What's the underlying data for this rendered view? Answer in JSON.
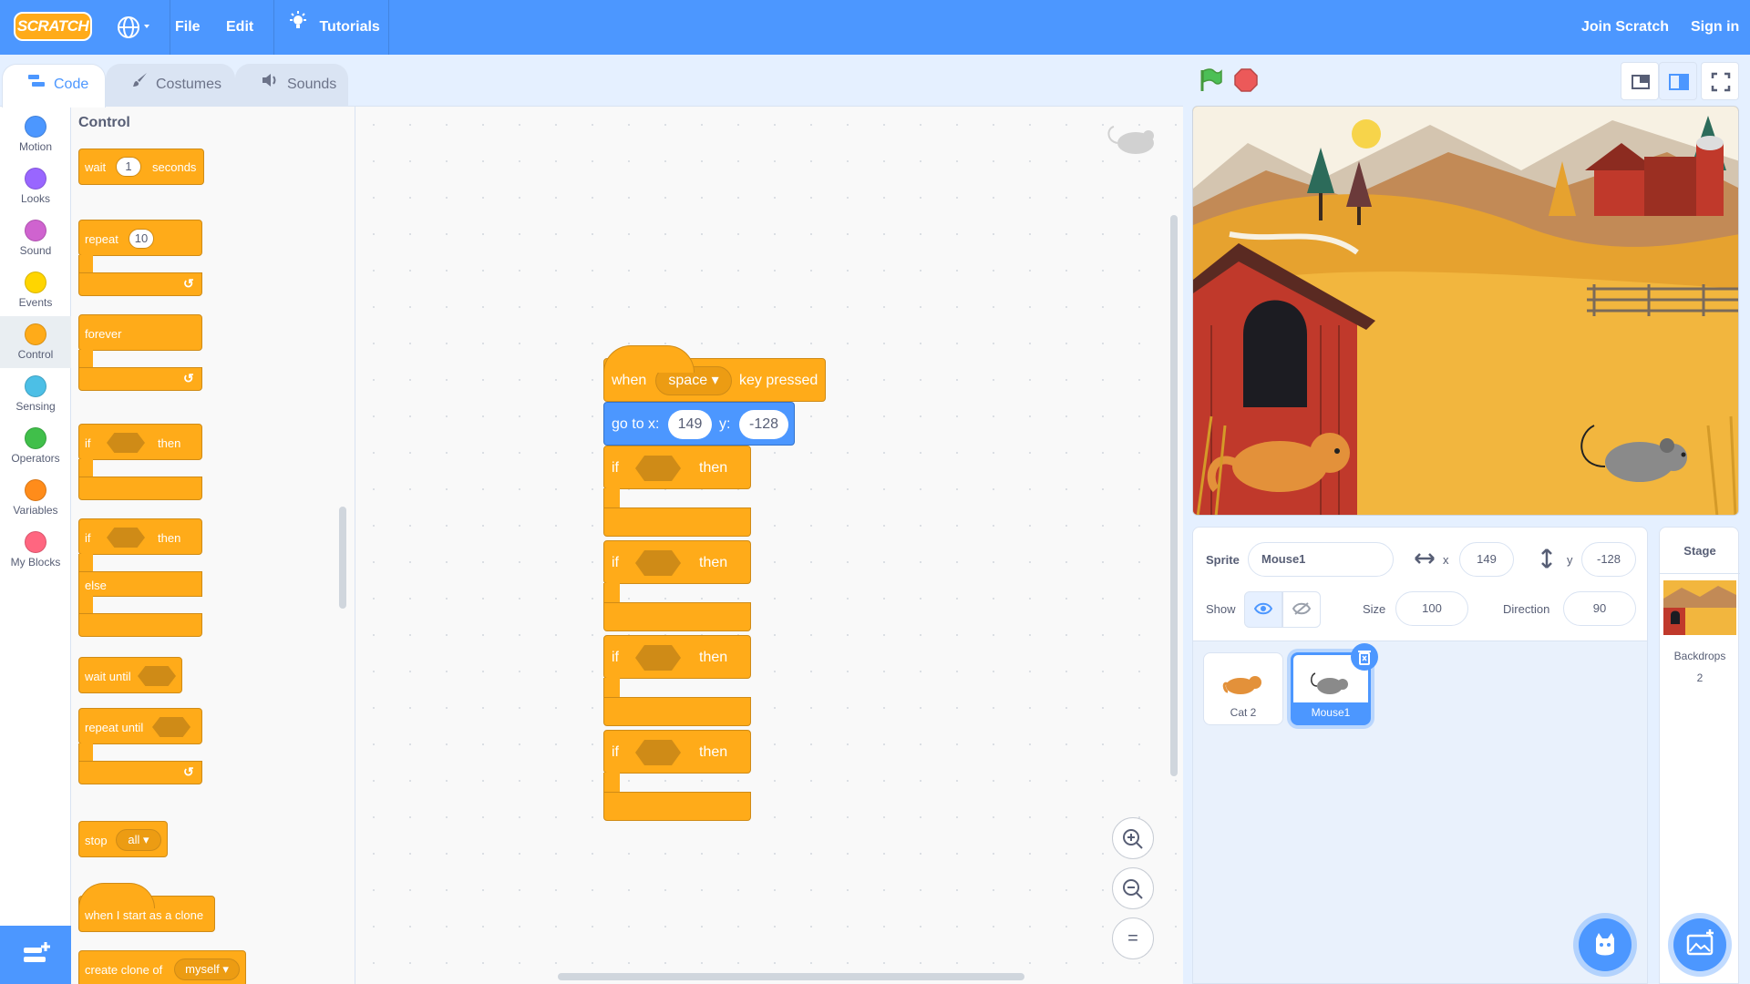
{
  "menubar": {
    "logo_text": "SCRATCH",
    "file": "File",
    "edit": "Edit",
    "tutorials": "Tutorials",
    "join": "Join Scratch",
    "signin": "Sign in"
  },
  "tabs": [
    {
      "label": "Code"
    },
    {
      "label": "Costumes"
    },
    {
      "label": "Sounds"
    }
  ],
  "categories": [
    {
      "label": "Motion",
      "color": "#4c97ff"
    },
    {
      "label": "Looks",
      "color": "#9966ff"
    },
    {
      "label": "Sound",
      "color": "#cf63cf"
    },
    {
      "label": "Events",
      "color": "#ffd500"
    },
    {
      "label": "Control",
      "color": "#ffab19"
    },
    {
      "label": "Sensing",
      "color": "#4cbfe6"
    },
    {
      "label": "Operators",
      "color": "#40bf4a"
    },
    {
      "label": "Variables",
      "color": "#ff8c1a"
    },
    {
      "label": "My Blocks",
      "color": "#ff6680"
    }
  ],
  "palette": {
    "title": "Control",
    "wait": {
      "prefix": "wait",
      "value": "1",
      "suffix": "seconds"
    },
    "repeat": {
      "prefix": "repeat",
      "value": "10"
    },
    "forever": "forever",
    "if_then": {
      "if": "if",
      "then": "then"
    },
    "if_else": {
      "if": "if",
      "then": "then",
      "else": "else"
    },
    "wait_until": "wait until",
    "repeat_until": "repeat until",
    "stop": {
      "prefix": "stop",
      "option": "all"
    },
    "clone_hat": "when I start as a clone",
    "create_clone": {
      "prefix": "create clone of",
      "option": "myself"
    }
  },
  "script": {
    "hat": {
      "when": "when",
      "key": "space",
      "suffix": "key pressed"
    },
    "goto": {
      "label": "go to x:",
      "x": "149",
      "ylabel": "y:",
      "y": "-128"
    },
    "ifs": [
      {
        "if": "if",
        "then": "then"
      },
      {
        "if": "if",
        "then": "then"
      },
      {
        "if": "if",
        "then": "then"
      },
      {
        "if": "if",
        "then": "then"
      }
    ]
  },
  "zoom": {
    "reset": "="
  },
  "sprite_info": {
    "sprite_label": "Sprite",
    "sprite_name": "Mouse1",
    "x_label": "x",
    "x": "149",
    "y_label": "y",
    "y": "-128",
    "show_label": "Show",
    "size_label": "Size",
    "size": "100",
    "direction_label": "Direction",
    "direction": "90"
  },
  "sprites": [
    {
      "name": "Cat 2",
      "selected": false
    },
    {
      "name": "Mouse1",
      "selected": true
    }
  ],
  "stage_pane": {
    "title": "Stage",
    "backdrops_label": "Backdrops",
    "backdrops_count": "2"
  },
  "colors": {
    "menubar": "#4c97ff",
    "control": "#ffab19",
    "motion": "#4c97ff",
    "green_flag": "#4cbf56",
    "stop": "#ec5959"
  }
}
